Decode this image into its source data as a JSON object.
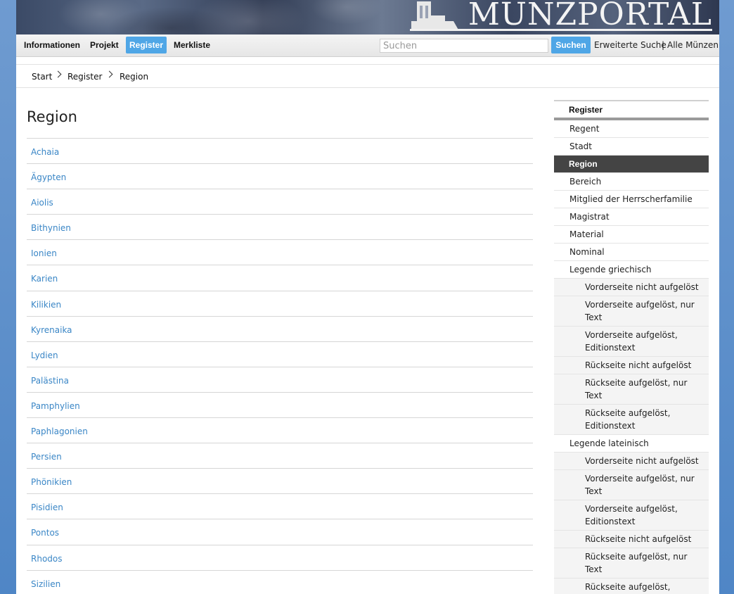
{
  "banner": {
    "logo_text": "MÜNZPORTAL"
  },
  "nav": {
    "items": [
      {
        "label": "Informationen"
      },
      {
        "label": "Projekt"
      },
      {
        "label": "Register",
        "active": true
      },
      {
        "label": "Merkliste"
      }
    ],
    "search_placeholder": "Suchen",
    "search_button": "Suchen",
    "advanced_search": "Erweiterte Suche",
    "separator": "|",
    "all_coins": "Alle Münzen"
  },
  "breadcrumb": [
    "Start",
    "Register",
    "Region"
  ],
  "main": {
    "title": "Region",
    "regions": [
      "Achaia",
      "Ägypten",
      "Aiolis",
      "Bithynien",
      "Ionien",
      "Karien",
      "Kilikien",
      "Kyrenaika",
      "Lydien",
      "Palästina",
      "Pamphylien",
      "Paphlagonien",
      "Persien",
      "Phönikien",
      "Pisidien",
      "Pontos",
      "Rhodos",
      "Sizilien"
    ]
  },
  "sidebar": {
    "heading": "Register",
    "items": [
      {
        "label": "Regent"
      },
      {
        "label": "Stadt"
      },
      {
        "label": "Region",
        "active": true
      },
      {
        "label": "Bereich"
      },
      {
        "label": "Mitglied der Herrscherfamilie"
      },
      {
        "label": "Magistrat"
      },
      {
        "label": "Material"
      },
      {
        "label": "Nominal"
      },
      {
        "label": "Legende griechisch"
      },
      {
        "label": "Vorderseite nicht aufgelöst",
        "sub": true
      },
      {
        "label": "Vorderseite aufgelöst, nur Text",
        "sub": true
      },
      {
        "label": "Vorderseite aufgelöst, Editionstext",
        "sub": true
      },
      {
        "label": "Rückseite nicht aufgelöst",
        "sub": true
      },
      {
        "label": "Rückseite aufgelöst, nur Text",
        "sub": true
      },
      {
        "label": "Rückseite aufgelöst, Editionstext",
        "sub": true
      },
      {
        "label": "Legende lateinisch"
      },
      {
        "label": "Vorderseite nicht aufgelöst",
        "sub": true
      },
      {
        "label": "Vorderseite aufgelöst, nur Text",
        "sub": true
      },
      {
        "label": "Vorderseite aufgelöst, Editionstext",
        "sub": true
      },
      {
        "label": "Rückseite nicht aufgelöst",
        "sub": true
      },
      {
        "label": "Rückseite aufgelöst, nur Text",
        "sub": true
      },
      {
        "label": "Rückseite aufgelöst, Editionstext",
        "sub": true
      }
    ]
  },
  "colors": {
    "accent": "#4fa6e6",
    "link": "#3a86c6",
    "sidebar_active": "#444444"
  }
}
